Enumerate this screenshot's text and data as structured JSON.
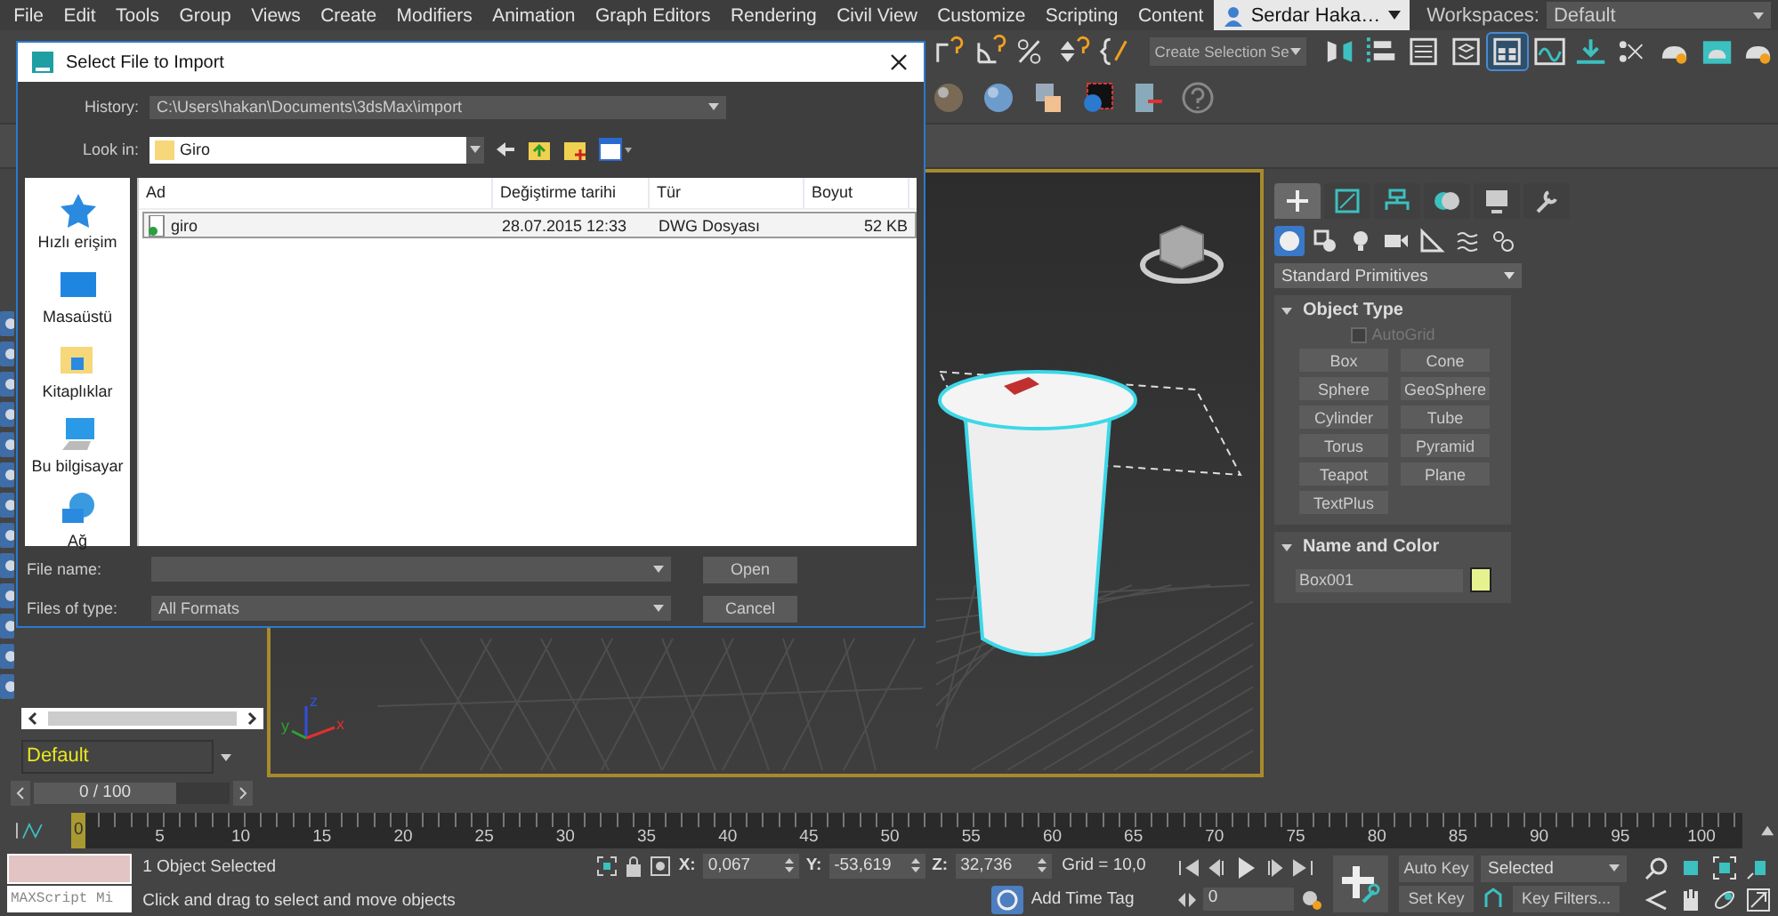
{
  "menu": [
    "File",
    "Edit",
    "Tools",
    "Group",
    "Views",
    "Create",
    "Modifiers",
    "Animation",
    "Graph Editors",
    "Rendering",
    "Civil View",
    "Customize",
    "Scripting",
    "Content"
  ],
  "user": {
    "name": "Serdar Haka…"
  },
  "workspaces": {
    "label": "Workspaces:",
    "value": "Default"
  },
  "toolbar": [
    {
      "kind": "snap",
      "selected": false
    },
    {
      "kind": "angle",
      "selected": false
    },
    {
      "kind": "percent",
      "selected": false
    },
    {
      "kind": "spinner",
      "selected": false
    },
    {
      "kind": "braces",
      "selected": false
    }
  ],
  "selection_set": "Create Selection Se",
  "toolbar_right": [
    {
      "kind": "mirror",
      "selected": false
    },
    {
      "kind": "align",
      "selected": false
    },
    {
      "kind": "list",
      "selected": false
    },
    {
      "kind": "layers",
      "selected": false
    },
    {
      "kind": "panel",
      "selected": true
    },
    {
      "kind": "curve",
      "selected": false
    },
    {
      "kind": "download",
      "selected": false
    },
    {
      "kind": "nodes",
      "selected": false
    },
    {
      "kind": "teapot",
      "selected": false
    },
    {
      "kind": "render",
      "selected": false
    },
    {
      "kind": "teapot",
      "selected": false
    }
  ],
  "toolbar2": [
    {
      "kind": "sphere",
      "selected": false
    },
    {
      "kind": "sphere",
      "selected": false
    },
    {
      "kind": "image",
      "selected": false
    },
    {
      "kind": "render",
      "selected": false
    },
    {
      "kind": "panel",
      "selected": false
    },
    {
      "kind": "help",
      "selected": false
    }
  ],
  "dialog": {
    "title": "Select File to Import",
    "history_label": "History:",
    "history": "C:\\Users\\hakan\\Documents\\3dsMax\\import",
    "look_in_label": "Look in:",
    "look_in": "Giro",
    "places": [
      {
        "label": "Hızlı erişim",
        "kind": "star"
      },
      {
        "label": "Masaüstü",
        "kind": "desktop"
      },
      {
        "label": "Kitaplıklar",
        "kind": "library"
      },
      {
        "label": "Bu bilgisayar",
        "kind": "computer"
      },
      {
        "label": "Ağ",
        "kind": "network"
      }
    ],
    "columns": [
      "Ad",
      "Değiştirme tarihi",
      "Tür",
      "Boyut"
    ],
    "files": [
      {
        "name": "giro",
        "modified": "28.07.2015 12:33",
        "type": "DWG Dosyası",
        "size": "52 KB",
        "selected": true
      }
    ],
    "file_name_label": "File name:",
    "file_type_label": "Files of type:",
    "file_type": "All Formats",
    "buttons": [
      "Open",
      "Cancel"
    ]
  },
  "viewport": {
    "axes": [
      "x",
      "y",
      "z"
    ]
  },
  "command_panel": {
    "tabs": [
      {
        "kind": "create",
        "selected": true
      },
      {
        "kind": "modify",
        "selected": false
      },
      {
        "kind": "hierarchy",
        "selected": false
      },
      {
        "kind": "motion",
        "selected": false
      },
      {
        "kind": "display",
        "selected": false
      },
      {
        "kind": "utilities",
        "selected": false
      }
    ],
    "categories": [
      {
        "kind": "geometry",
        "selected": true
      },
      {
        "kind": "shapes",
        "selected": false
      },
      {
        "kind": "lights",
        "selected": false
      },
      {
        "kind": "cameras",
        "selected": false
      },
      {
        "kind": "helpers",
        "selected": false
      },
      {
        "kind": "spacewarps",
        "selected": false
      },
      {
        "kind": "systems",
        "selected": false
      }
    ],
    "category": "Standard Primitives",
    "object_type": {
      "title": "Object Type",
      "autogrid": {
        "label": "AutoGrid",
        "checked": false,
        "disabled": true
      },
      "buttons": [
        "Box",
        "Cone",
        "Sphere",
        "GeoSphere",
        "Cylinder",
        "Tube",
        "Torus",
        "Pyramid",
        "Teapot",
        "Plane",
        "TextPlus"
      ]
    },
    "name_color": {
      "title": "Name and Color",
      "name": "Box001",
      "color": "#e6f290"
    }
  },
  "layer": "Default",
  "time_slider": {
    "label": "0 / 100",
    "level": 0
  },
  "timeline": {
    "current": "0",
    "ticks": [
      "5",
      "10",
      "15",
      "20",
      "25",
      "30",
      "35",
      "40",
      "45",
      "50",
      "55",
      "60",
      "65",
      "70",
      "75",
      "80",
      "85",
      "90",
      "95",
      "100"
    ]
  },
  "status": {
    "maxscript": "MAXScript Mi",
    "selected": "1 Object Selected",
    "prompt": "Click and drag to select and move objects",
    "coords": [
      {
        "label": "X:",
        "value": "0,067"
      },
      {
        "label": "Y:",
        "value": "-53,619"
      },
      {
        "label": "Z:",
        "value": "32,736"
      }
    ],
    "grid": "Grid = 10,0",
    "time_tag": "Add Time Tag",
    "auto_key": "Auto Key",
    "set_key": "Set Key",
    "key_mode": "Selected",
    "key_filters": "Key Filters...",
    "frame": "0"
  }
}
